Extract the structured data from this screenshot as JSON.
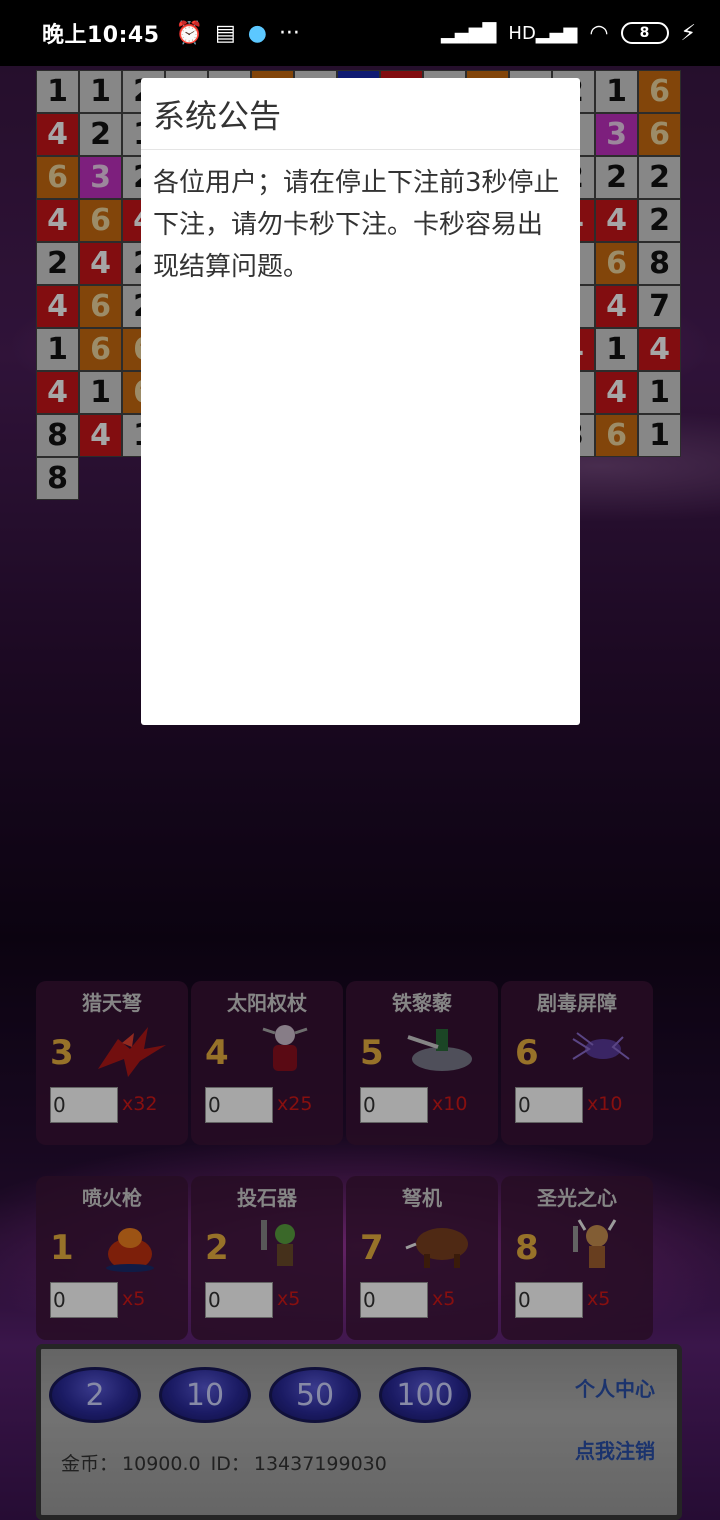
{
  "status_bar": {
    "time": "晚上10:45",
    "icons_left": [
      "alarm-icon",
      "message-icon",
      "qq-icon",
      "more-icon"
    ],
    "battery": "8"
  },
  "grid": {
    "cells": [
      [
        "1",
        "gray"
      ],
      [
        "1",
        "gray"
      ],
      [
        "2",
        "gray"
      ],
      [
        "",
        "gray"
      ],
      [
        "",
        "gray"
      ],
      [
        "",
        "orange"
      ],
      [
        "",
        "gray"
      ],
      [
        "",
        "blue"
      ],
      [
        "",
        "red"
      ],
      [
        "",
        "gray"
      ],
      [
        "",
        "orange"
      ],
      [
        "",
        "gray"
      ],
      [
        "2",
        "gray"
      ],
      [
        "1",
        "gray"
      ],
      [
        "6",
        "orange"
      ],
      [
        "4",
        "red"
      ],
      [
        "2",
        "gray"
      ],
      [
        "1",
        "gray"
      ],
      [
        "",
        "gray"
      ],
      [
        "",
        "gray"
      ],
      [
        "",
        "gray"
      ],
      [
        "",
        "gray"
      ],
      [
        "",
        "gray"
      ],
      [
        "",
        "gray"
      ],
      [
        "",
        "gray"
      ],
      [
        "",
        "gray"
      ],
      [
        "",
        "gray"
      ],
      [
        "",
        "gray"
      ],
      [
        "3",
        "pink"
      ],
      [
        "6",
        "orange"
      ],
      [
        "6",
        "orange"
      ],
      [
        "3",
        "pink"
      ],
      [
        "2",
        "gray"
      ],
      [
        "",
        "gray"
      ],
      [
        "",
        "gray"
      ],
      [
        "",
        "gray"
      ],
      [
        "",
        "gray"
      ],
      [
        "",
        "gray"
      ],
      [
        "",
        "gray"
      ],
      [
        "",
        "gray"
      ],
      [
        "",
        "gray"
      ],
      [
        "",
        "gray"
      ],
      [
        "2",
        "gray"
      ],
      [
        "2",
        "gray"
      ],
      [
        "2",
        "gray"
      ],
      [
        "4",
        "red"
      ],
      [
        "6",
        "orange"
      ],
      [
        "4",
        "red"
      ],
      [
        "",
        "gray"
      ],
      [
        "",
        "gray"
      ],
      [
        "",
        "gray"
      ],
      [
        "",
        "gray"
      ],
      [
        "",
        "gray"
      ],
      [
        "",
        "gray"
      ],
      [
        "",
        "gray"
      ],
      [
        "",
        "gray"
      ],
      [
        "",
        "gray"
      ],
      [
        "4",
        "red"
      ],
      [
        "4",
        "red"
      ],
      [
        "2",
        "gray"
      ],
      [
        "2",
        "gray"
      ],
      [
        "4",
        "red"
      ],
      [
        "2",
        "gray"
      ],
      [
        "",
        "gray"
      ],
      [
        "",
        "gray"
      ],
      [
        "",
        "gray"
      ],
      [
        "",
        "gray"
      ],
      [
        "",
        "gray"
      ],
      [
        "",
        "gray"
      ],
      [
        "",
        "gray"
      ],
      [
        "",
        "gray"
      ],
      [
        "",
        "gray"
      ],
      [
        "",
        "gray"
      ],
      [
        "6",
        "orange"
      ],
      [
        "8",
        "gray"
      ],
      [
        "4",
        "red"
      ],
      [
        "6",
        "orange"
      ],
      [
        "2",
        "gray"
      ],
      [
        "",
        "gray"
      ],
      [
        "",
        "gray"
      ],
      [
        "",
        "gray"
      ],
      [
        "",
        "gray"
      ],
      [
        "",
        "gray"
      ],
      [
        "",
        "gray"
      ],
      [
        "",
        "gray"
      ],
      [
        "",
        "gray"
      ],
      [
        "",
        "gray"
      ],
      [
        "",
        "gray"
      ],
      [
        "4",
        "red"
      ],
      [
        "7",
        "gray"
      ],
      [
        "1",
        "gray"
      ],
      [
        "6",
        "orange"
      ],
      [
        "6",
        "orange"
      ],
      [
        "",
        "gray"
      ],
      [
        "",
        "gray"
      ],
      [
        "",
        "gray"
      ],
      [
        "",
        "gray"
      ],
      [
        "",
        "gray"
      ],
      [
        "",
        "gray"
      ],
      [
        "",
        "gray"
      ],
      [
        "",
        "gray"
      ],
      [
        "",
        "gray"
      ],
      [
        "4",
        "red"
      ],
      [
        "1",
        "gray"
      ],
      [
        "4",
        "red"
      ],
      [
        "4",
        "red"
      ],
      [
        "1",
        "gray"
      ],
      [
        "6",
        "orange"
      ],
      [
        "",
        "gray"
      ],
      [
        "",
        "gray"
      ],
      [
        "",
        "gray"
      ],
      [
        "",
        "gray"
      ],
      [
        "",
        "gray"
      ],
      [
        "",
        "gray"
      ],
      [
        "",
        "gray"
      ],
      [
        "",
        "gray"
      ],
      [
        "",
        "gray"
      ],
      [
        "",
        "gray"
      ],
      [
        "4",
        "red"
      ],
      [
        "1",
        "gray"
      ],
      [
        "8",
        "gray"
      ],
      [
        "4",
        "red"
      ],
      [
        "1",
        "gray"
      ],
      [
        "",
        "gray"
      ],
      [
        "",
        "gray"
      ],
      [
        "",
        "gray"
      ],
      [
        "",
        "gray"
      ],
      [
        "",
        "gray"
      ],
      [
        "",
        "gray"
      ],
      [
        "",
        "gray"
      ],
      [
        "",
        "gray"
      ],
      [
        "",
        "gray"
      ],
      [
        "3",
        "gray"
      ],
      [
        "6",
        "orange"
      ],
      [
        "1",
        "gray"
      ],
      [
        "8",
        "gray"
      ]
    ]
  },
  "cards": [
    {
      "title": "猎天弩",
      "num": "3",
      "value": "0",
      "mult": "x32",
      "art": "dragon"
    },
    {
      "title": "太阳权杖",
      "num": "4",
      "value": "0",
      "mult": "x25",
      "art": "demon"
    },
    {
      "title": "铁黎藜",
      "num": "5",
      "value": "0",
      "mult": "x10",
      "art": "wolf-rider"
    },
    {
      "title": "剧毒屏障",
      "num": "6",
      "value": "0",
      "mult": "x10",
      "art": "spider"
    },
    {
      "title": "喷火枪",
      "num": "1",
      "value": "0",
      "mult": "x5",
      "art": "fire-pot"
    },
    {
      "title": "投石器",
      "num": "2",
      "value": "0",
      "mult": "x5",
      "art": "goblin"
    },
    {
      "title": "弩机",
      "num": "7",
      "value": "0",
      "mult": "x5",
      "art": "boar"
    },
    {
      "title": "圣光之心",
      "num": "8",
      "value": "0",
      "mult": "x5",
      "art": "viking"
    }
  ],
  "chips": [
    "2",
    "10",
    "50",
    "100"
  ],
  "panel": {
    "personal_center": "个人中心",
    "logout": "点我注销",
    "coins_label": "金币：",
    "coins_value": "10900.0",
    "id_label": "ID：",
    "id_value": "13437199030"
  },
  "dialog": {
    "title": "系统公告",
    "body": "各位用户；请在停止下注前3秒停止下注，请勿卡秒下注。卡秒容易出现结算问题。"
  },
  "colors": {
    "gray": "#cfcfcf",
    "red": "#c8141a",
    "orange": "#c86a10",
    "pink": "#c030c0",
    "blue": "#1a2ab0",
    "multiplier": "#d01818",
    "link": "#2a4fa8"
  }
}
